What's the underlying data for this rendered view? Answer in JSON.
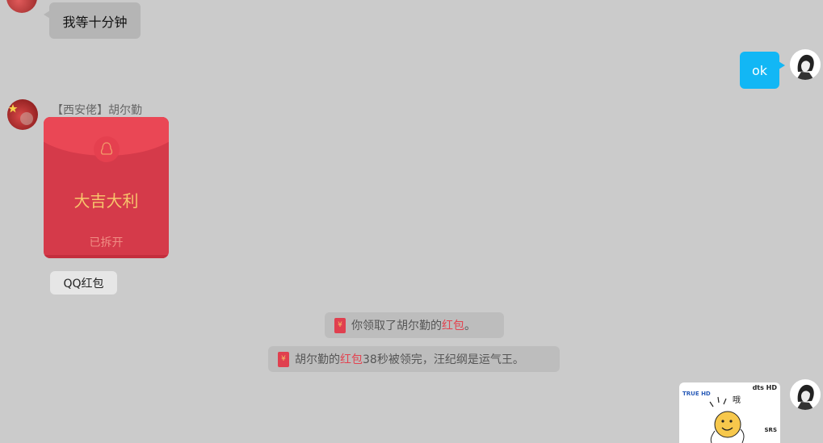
{
  "messages": {
    "wait": {
      "text": "我等十分钟"
    },
    "ok": {
      "text": "ok"
    },
    "sender": {
      "name": "【西安佬】胡尔勤"
    },
    "red_packet": {
      "title": "大吉大利",
      "status": "已拆开",
      "type_label": "QQ红包"
    },
    "system1": {
      "icon": "red-packet-icon",
      "icon_glyph": "¥",
      "prefix": "你领取了胡尔勤的",
      "link": "红包",
      "suffix": "。"
    },
    "system2": {
      "icon": "red-packet-icon",
      "icon_glyph": "¥",
      "prefix": "胡尔勤的",
      "link": "红包",
      "suffix": "38秒被领完，汪纪纲是运气王。"
    },
    "sticker": {
      "badge_left": "TRUE HD",
      "badge_right": "dts HD",
      "caption": "哦",
      "badge_bottom": "SRS"
    }
  },
  "colors": {
    "bg": "#cbcbcb",
    "accent": "#12b7f5",
    "red_packet": "#d53a4a",
    "highlight": "#e3424f"
  }
}
